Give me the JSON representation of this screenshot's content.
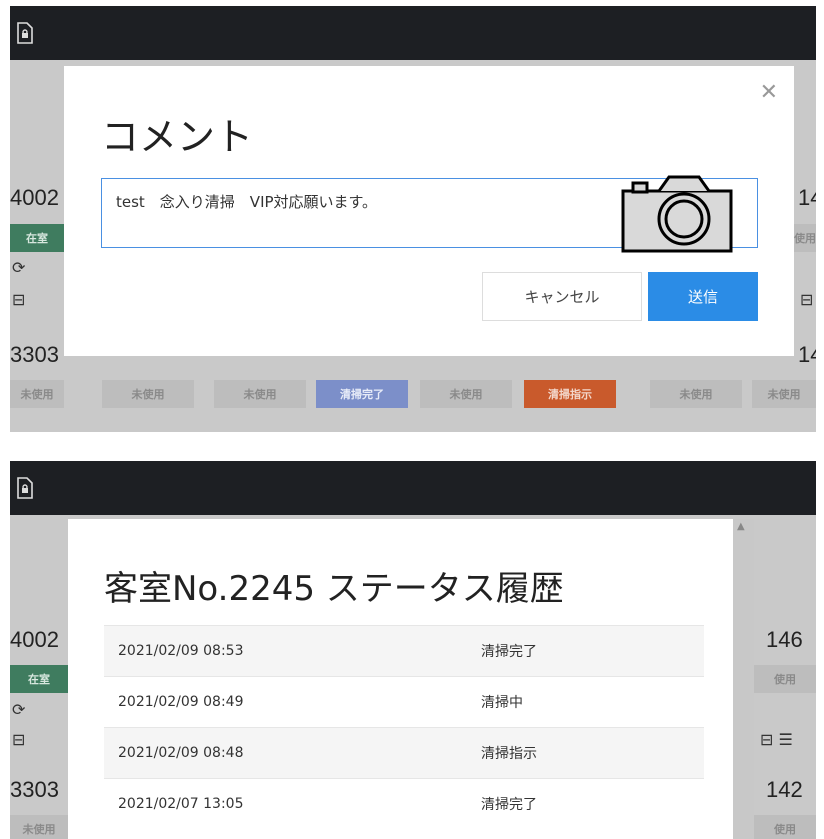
{
  "comment_dialog": {
    "title": "コメント",
    "comment_value": "test　念入り清掃　VIP対応願います。",
    "cancel_label": "キャンセル",
    "send_label": "送信"
  },
  "history_dialog": {
    "title": "客室No.2245 ステータス履歴",
    "rows": [
      {
        "date": "2021/02/09 08:53",
        "status": "清掃完了"
      },
      {
        "date": "2021/02/09 08:49",
        "status": "清掃中"
      },
      {
        "date": "2021/02/09 08:48",
        "status": "清掃指示"
      },
      {
        "date": "2021/02/07 13:05",
        "status": "清掃完了"
      }
    ]
  },
  "background": {
    "room_4002": "4002",
    "room_3303": "3303",
    "room_146": "146",
    "room_142": "142",
    "room_1461": "146",
    "room_1421": "142",
    "status_occupied": "在室",
    "status_unused": "未使用",
    "status_clean_done": "清掃完了",
    "status_clean_order": "清掃指示",
    "status_unused_short": "使用"
  },
  "colors": {
    "primary": "#2b8ce6",
    "topbar": "#1d1f23",
    "clean_order": "#c95a2c",
    "clean_done": "#7c8fc9",
    "occupied": "#3f7c5f"
  }
}
